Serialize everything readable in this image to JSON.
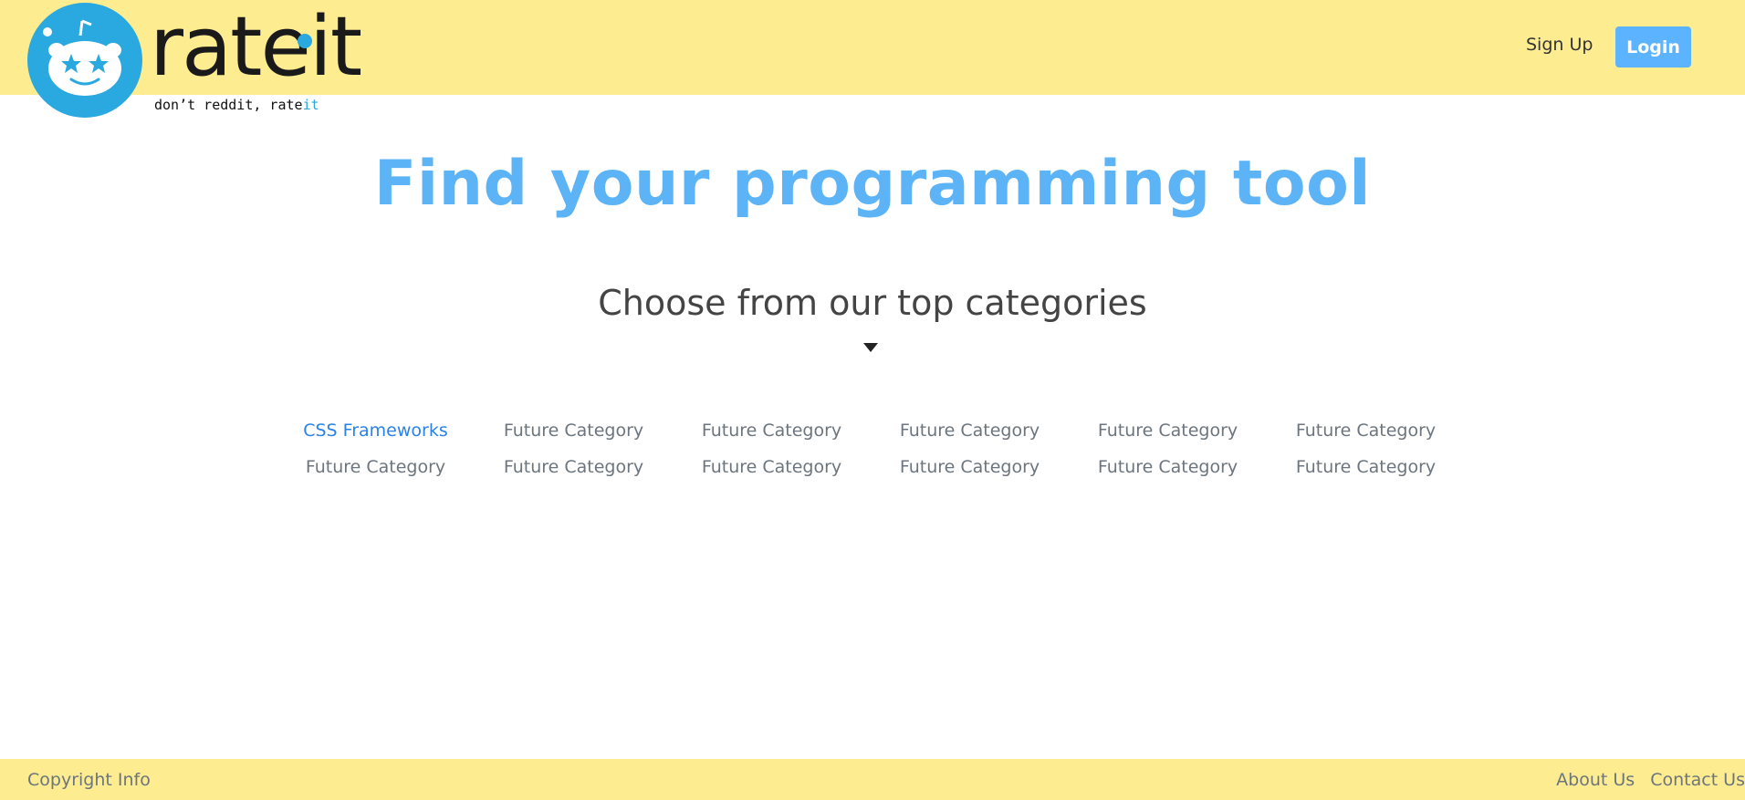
{
  "brand": {
    "name": "rateit",
    "tagline_prefix": "don’t reddit, rate",
    "tagline_suffix": "it",
    "icon": "alien-face-star-eyes-icon",
    "accent_color": "#2aa8e0"
  },
  "nav": {
    "signup_label": "Sign Up",
    "login_label": "Login"
  },
  "hero": {
    "title": "Find your programming tool",
    "subtitle": "Choose from our top categories"
  },
  "categories": [
    "CSS Frameworks",
    "Future Category",
    "Future Category",
    "Future Category",
    "Future Category",
    "Future Category",
    "Future Category",
    "Future Category",
    "Future Category",
    "Future Category",
    "Future Category",
    "Future Category"
  ],
  "footer": {
    "copyright": "Copyright Info",
    "about_label": "About Us",
    "contact_label": "Contact Us"
  },
  "colors": {
    "header_bg": "#feec91",
    "hero_title": "#5cb3f5",
    "login_bg": "#5cb3ff",
    "active_link": "#2a82e8"
  }
}
